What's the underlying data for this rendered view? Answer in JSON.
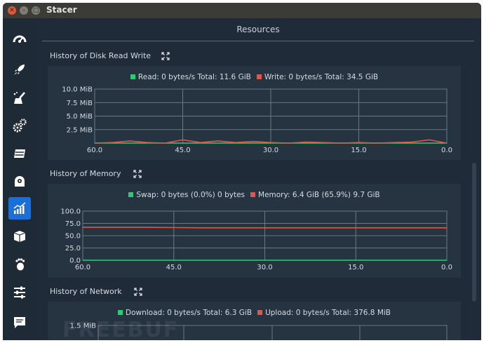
{
  "window": {
    "title": "Stacer"
  },
  "header": {
    "title": "Resources"
  },
  "sidebar": {
    "items": [
      {
        "name": "dashboard",
        "icon": "speedometer-icon",
        "active": false
      },
      {
        "name": "startup-apps",
        "icon": "rocket-icon",
        "active": false
      },
      {
        "name": "system-cleaner",
        "icon": "broom-icon",
        "active": false
      },
      {
        "name": "services",
        "icon": "gears-icon",
        "active": false
      },
      {
        "name": "processes",
        "icon": "processes-icon",
        "active": false
      },
      {
        "name": "uninstaller",
        "icon": "disk-icon",
        "active": false
      },
      {
        "name": "resources",
        "icon": "chart-icon",
        "active": true
      },
      {
        "name": "apt-repository",
        "icon": "package-icon",
        "active": false
      },
      {
        "name": "gnome-settings",
        "icon": "gnome-foot-icon",
        "active": false
      },
      {
        "name": "settings",
        "icon": "sliders-icon",
        "active": false
      },
      {
        "name": "feedback",
        "icon": "feedback-icon",
        "active": false
      }
    ]
  },
  "colors": {
    "green": "#2ecc71",
    "red": "#e0574a",
    "accent": "#1a6fd8"
  },
  "sections": {
    "disk": {
      "title": "History of Disk Read Write",
      "legend_read": "Read: 0 bytes/s Total: 11.6 GiB",
      "legend_write": "Write: 0 bytes/s Total: 34.5 GiB"
    },
    "memory": {
      "title": "History of Memory",
      "legend_swap": "Swap: 0 bytes (0.0%) 0 bytes",
      "legend_memory": "Memory: 6.4 GiB (65.9%) 9.7 GiB"
    },
    "network": {
      "title": "History of Network",
      "legend_download": "Download: 0 bytes/s Total: 6.3 GiB",
      "legend_upload": "Upload: 0 bytes/s Total: 376.8 MiB"
    }
  },
  "watermark": "FREEBUF",
  "chart_data": [
    {
      "type": "line",
      "x": [
        60,
        57,
        54,
        51,
        48,
        45,
        42,
        39,
        36,
        33,
        30,
        27,
        24,
        21,
        18,
        15,
        12,
        9,
        6,
        3,
        0
      ],
      "xlim": [
        60,
        0
      ],
      "ylim": [
        0,
        10
      ],
      "yticks": [
        2.5,
        5.0,
        7.5,
        10.0
      ],
      "ytick_labels": [
        "2.5 MiB",
        "5.0 MiB",
        "7.5 MiB",
        "10.0 MiB"
      ],
      "xtick_labels": [
        "60.0",
        "45.0",
        "30.0",
        "15.0",
        "0.0"
      ],
      "series": [
        {
          "name": "Read",
          "color": "#2ecc71",
          "values": [
            0,
            0,
            0,
            0,
            0,
            0,
            0,
            0,
            0,
            0,
            0,
            0,
            0,
            0,
            0,
            0,
            0,
            0,
            0,
            0,
            0
          ]
        },
        {
          "name": "Write",
          "color": "#e0574a",
          "values": [
            0,
            0.1,
            0.4,
            0.1,
            0,
            0.6,
            0.1,
            0.4,
            0.1,
            0.3,
            0.1,
            0,
            0.2,
            0.1,
            0,
            0.1,
            0,
            0.1,
            0.2,
            0.6,
            0
          ]
        }
      ]
    },
    {
      "type": "line",
      "x": [
        60,
        50,
        40,
        30,
        20,
        10,
        0
      ],
      "xlim": [
        60,
        0
      ],
      "ylim": [
        0,
        100
      ],
      "yticks": [
        0,
        25,
        50,
        75,
        100
      ],
      "ytick_labels": [
        "0.0",
        "25.0",
        "50.0",
        "75.0",
        "100.0"
      ],
      "xtick_labels": [
        "60.0",
        "45.0",
        "30.0",
        "15.0",
        "0.0"
      ],
      "series": [
        {
          "name": "Swap",
          "color": "#2ecc71",
          "values": [
            0,
            0,
            0,
            0,
            0,
            0,
            0
          ]
        },
        {
          "name": "Memory",
          "color": "#e0574a",
          "values": [
            67,
            67,
            66,
            66,
            66,
            66,
            66
          ]
        }
      ]
    },
    {
      "type": "line",
      "ylim": [
        0,
        1.5
      ],
      "yticks": [
        1.5
      ],
      "ytick_labels": [
        "1.5 MiB"
      ],
      "series": [
        {
          "name": "Download",
          "color": "#2ecc71"
        },
        {
          "name": "Upload",
          "color": "#e0574a"
        }
      ]
    }
  ]
}
